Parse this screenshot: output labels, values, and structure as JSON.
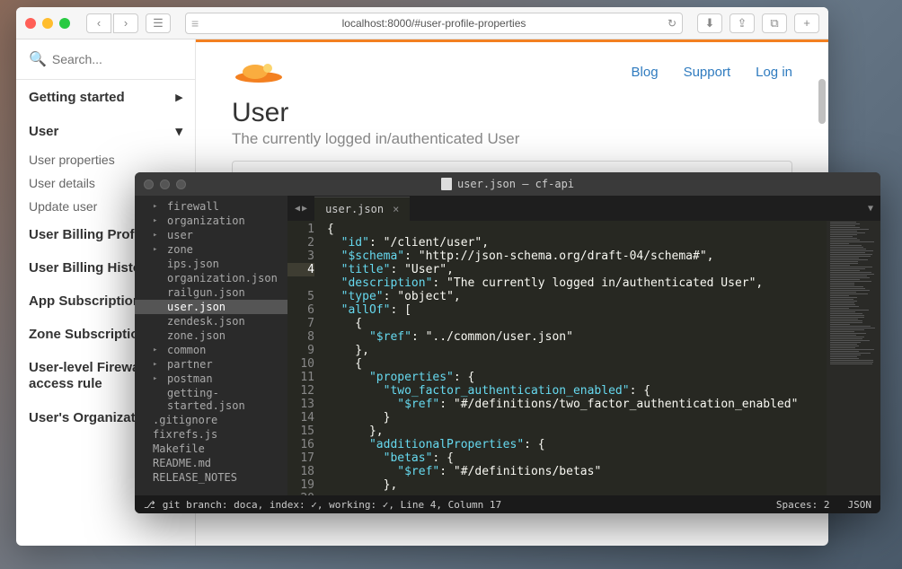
{
  "browser": {
    "url": "localhost:8000/#user-profile-properties",
    "search_placeholder": "Search...",
    "sidebar": {
      "items": [
        {
          "label": "Getting started",
          "bold": true,
          "chevron": "right"
        },
        {
          "label": "User",
          "bold": true,
          "chevron": "down"
        }
      ],
      "subs": [
        "User properties",
        "User details",
        "Update user"
      ],
      "items2": [
        "User Billing Profile",
        "User Billing History",
        "App Subscription",
        "Zone Subscription",
        "User-level Firewall access rule",
        "User's Organizations"
      ]
    },
    "topnav": [
      "Blog",
      "Support",
      "Log in"
    ],
    "heading": "User",
    "subtitle": "The currently logged in/authenticated User"
  },
  "editor": {
    "title": "user.json — cf-api",
    "tab": "user.json",
    "tree": [
      {
        "label": "firewall",
        "folder": true
      },
      {
        "label": "organization",
        "folder": true
      },
      {
        "label": "user",
        "folder": true
      },
      {
        "label": "zone",
        "folder": true
      },
      {
        "label": "ips.json",
        "nested": true
      },
      {
        "label": "organization.json",
        "nested": true
      },
      {
        "label": "railgun.json",
        "nested": true
      },
      {
        "label": "user.json",
        "nested": true,
        "selected": true
      },
      {
        "label": "zendesk.json",
        "nested": true
      },
      {
        "label": "zone.json",
        "nested": true
      },
      {
        "label": "common",
        "folder": true
      },
      {
        "label": "partner",
        "folder": true
      },
      {
        "label": "postman",
        "folder": true
      },
      {
        "label": "getting-started.json",
        "nested": true
      },
      {
        "label": ".gitignore"
      },
      {
        "label": "fixrefs.js"
      },
      {
        "label": "Makefile"
      },
      {
        "label": "README.md"
      },
      {
        "label": "RELEASE_NOTES"
      }
    ],
    "code": {
      "lines": [
        "{",
        "  \"id\": \"/client/user\",",
        "  \"$schema\": \"http://json-schema.org/draft-04/schema#\",",
        "  \"title\": \"User\",",
        "  \"description\": \"The currently logged in/authenticated User\",",
        "  \"type\": \"object\",",
        "  \"allOf\": [",
        "    {",
        "      \"$ref\": \"../common/user.json\"",
        "    },",
        "    {",
        "      \"properties\": {",
        "        \"two_factor_authentication_enabled\": {",
        "          \"$ref\": \"#/definitions/two_factor_authentication_enabled\"",
        "        }",
        "      },",
        "      \"additionalProperties\": {",
        "        \"betas\": {",
        "          \"$ref\": \"#/definitions/betas\"",
        "        },"
      ],
      "highlight_line": 4
    },
    "status": {
      "left": "git branch: doca, index: ✓, working: ✓, Line 4, Column 17",
      "spaces": "Spaces: 2",
      "lang": "JSON"
    }
  }
}
